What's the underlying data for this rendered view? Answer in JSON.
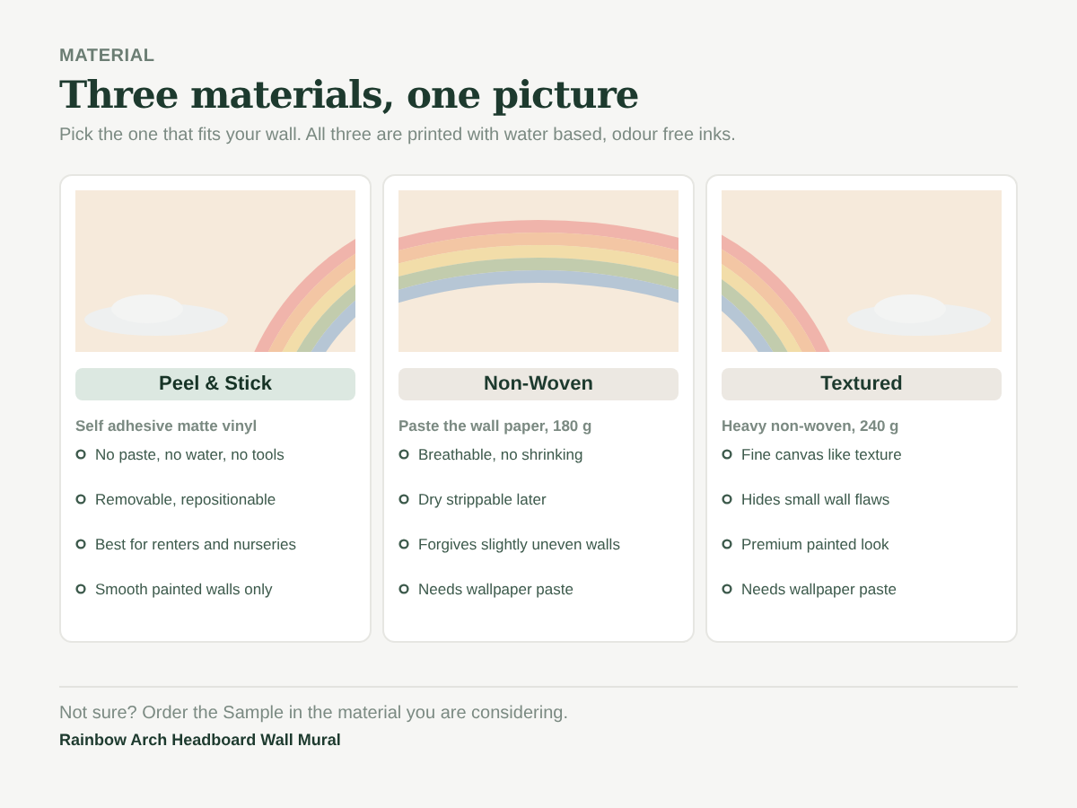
{
  "eyebrow": "MATERIAL",
  "title": "Three materials, one picture",
  "subtitle": "Pick the one that fits your wall. All three are printed with water based, odour free inks.",
  "materials": [
    {
      "name": "Peel & Stick",
      "selected": true,
      "kind": "left",
      "spec": "Self adhesive matte vinyl",
      "features": [
        "No paste, no water, no tools",
        "Removable, repositionable",
        "Best for renters and nurseries",
        "Smooth painted walls only"
      ]
    },
    {
      "name": "Non-Woven",
      "selected": false,
      "kind": "middle",
      "spec": "Paste the wall paper, 180 g",
      "features": [
        "Breathable, no shrinking",
        "Dry strippable later",
        "Forgives slightly uneven walls",
        "Needs wallpaper paste"
      ]
    },
    {
      "name": "Textured",
      "selected": false,
      "kind": "right",
      "spec": "Heavy non-woven, 240 g",
      "features": [
        "Fine canvas like texture",
        "Hides small wall flaws",
        "Premium painted look",
        "Needs wallpaper paste"
      ]
    }
  ],
  "footer": {
    "note": "Not sure? Order the Sample in the material you are considering.",
    "product": "Rainbow Arch Headboard Wall Mural"
  }
}
